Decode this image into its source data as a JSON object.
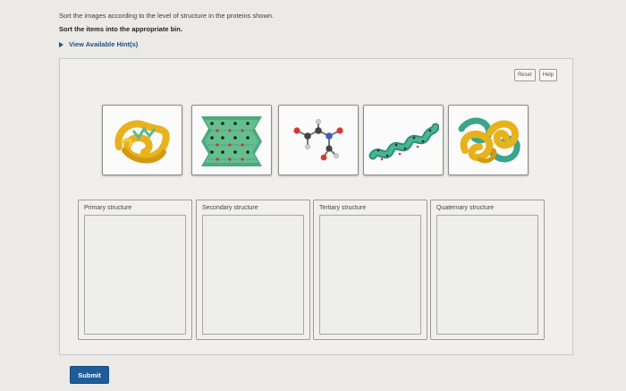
{
  "question": {
    "instruction": "Sort the images according to the level of structure in the proteins shown.",
    "subinstruction": "Sort the items into the appropriate bin.",
    "hints_label": "View Available Hint(s)"
  },
  "toolbar": {
    "reset_label": "Reset",
    "help_label": "Help"
  },
  "tiles": [
    {
      "icon": "protein-tertiary-fold-icon"
    },
    {
      "icon": "beta-sheet-icon"
    },
    {
      "icon": "amino-acid-chain-icon"
    },
    {
      "icon": "alpha-helix-icon"
    },
    {
      "icon": "protein-quaternary-complex-icon"
    }
  ],
  "bins": [
    {
      "label": "Primary structure"
    },
    {
      "label": "Secondary structure"
    },
    {
      "label": "Tertiary structure"
    },
    {
      "label": "Quaternary structure"
    }
  ],
  "submit_label": "Submit",
  "colors": {
    "accent": "#1f5d98",
    "link": "#1f4f86",
    "ribbon_gold": "#e8b21c",
    "ribbon_green": "#3aa58a"
  }
}
